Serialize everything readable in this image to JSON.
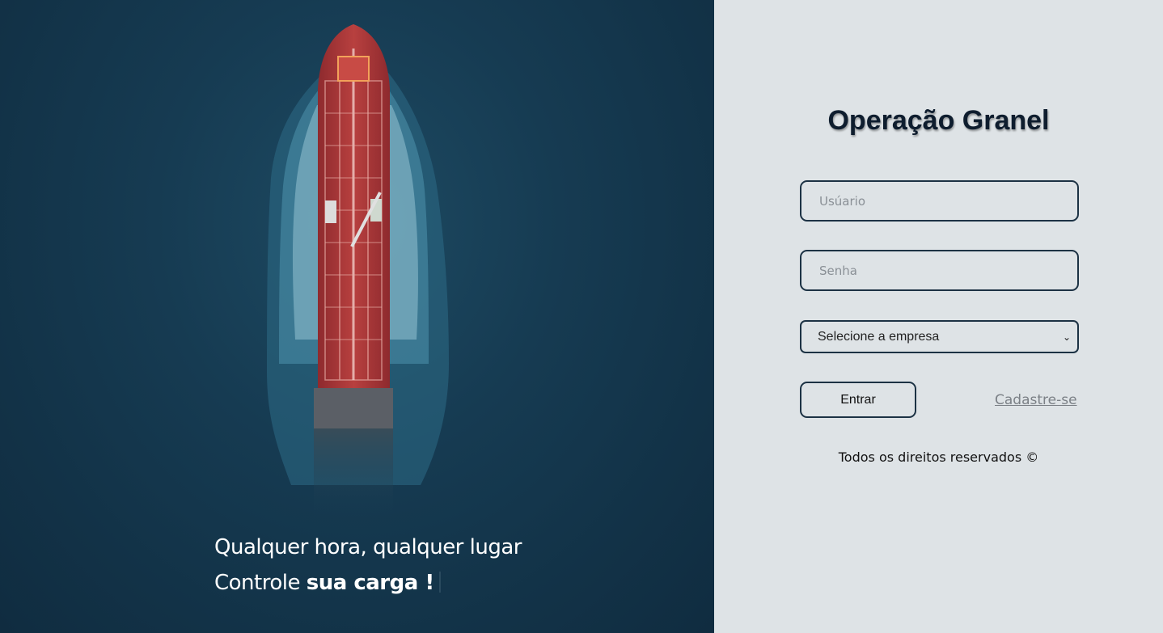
{
  "hero": {
    "line1": "Qualquer hora, qualquer lugar",
    "line2_prefix": "Controle ",
    "line2_bold": "sua carga !"
  },
  "login": {
    "title": "Operação Granel",
    "username_placeholder": "Usúario",
    "password_placeholder": "Senha",
    "company_select_value": "Selecione a empresa",
    "submit_label": "Entrar",
    "register_label": "Cadastre-se",
    "footer": "Todos os direitos reservados ©"
  },
  "colors": {
    "sea": "#163b52",
    "panel": "#dee3e6",
    "border": "#1c3244",
    "ship_hull": "#b23a3a"
  }
}
